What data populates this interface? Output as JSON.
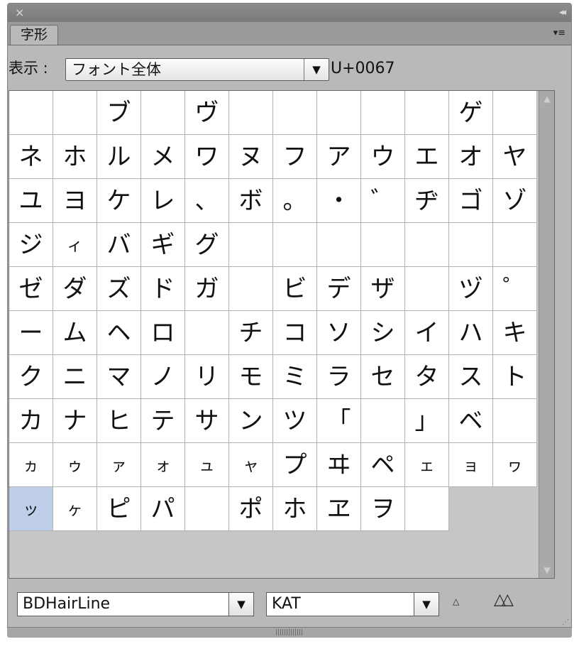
{
  "panel": {
    "tab_label": "字形",
    "close_icon": "×",
    "collapse_icon": "◂◂",
    "menu_icon": "▾≡"
  },
  "display": {
    "label": "表示 :",
    "selected": "フォント全体",
    "arrow": "▼",
    "unicode": "U+0067"
  },
  "glyph_grid": {
    "columns": 12,
    "selected_index": 108,
    "small_glyphs": [
      "ィ",
      "ヵ",
      "ゥ",
      "ァ",
      "ォ",
      "ュ",
      "ャ",
      "ェ",
      "ョ",
      "ヮ",
      "ッ",
      "ヶ"
    ],
    "cells": [
      "",
      "",
      "ブ",
      "",
      "ヴ",
      "",
      "",
      "",
      "",
      "",
      "ゲ",
      "",
      "ネ",
      "ホ",
      "ル",
      "メ",
      "ワ",
      "ヌ",
      "フ",
      "ア",
      "ウ",
      "エ",
      "オ",
      "ヤ",
      "ユ",
      "ヨ",
      "ケ",
      "レ",
      "、",
      "ボ",
      "。",
      "・",
      "゛",
      "ヂ",
      "ゴ",
      "ゾ",
      "ジ",
      "ィ",
      "バ",
      "ギ",
      "グ",
      "",
      "",
      "",
      "",
      "",
      "",
      "",
      "ゼ",
      "ダ",
      "ズ",
      "ド",
      "ガ",
      "",
      "ビ",
      "デ",
      "ザ",
      "",
      "ヅ",
      "゜",
      "ー",
      "ム",
      "ヘ",
      "ロ",
      "",
      "チ",
      "コ",
      "ソ",
      "シ",
      "イ",
      "ハ",
      "キ",
      "ク",
      "ニ",
      "マ",
      "ノ",
      "リ",
      "モ",
      "ミ",
      "ラ",
      "セ",
      "タ",
      "ス",
      "ト",
      "カ",
      "ナ",
      "ヒ",
      "テ",
      "サ",
      "ン",
      "ツ",
      "「",
      "",
      "」",
      "ベ",
      "",
      "ヵ",
      "ゥ",
      "ァ",
      "ォ",
      "ュ",
      "ャ",
      "プ",
      "ヰ",
      "ペ",
      "ェ",
      "ョ",
      "ヮ",
      "ッ",
      "ヶ",
      "ピ",
      "パ",
      "",
      "ポ",
      "ホ",
      "ヱ",
      "ヲ",
      ""
    ]
  },
  "scrollbar": {
    "up_icon": "▲",
    "down_icon": "▼"
  },
  "footer": {
    "font_family": "BDHairLine",
    "font_style": "KAT",
    "arrow": "▼",
    "zoom_out_icon": "△",
    "zoom_in_icon": "△△",
    "resize_icon": "⋰"
  }
}
